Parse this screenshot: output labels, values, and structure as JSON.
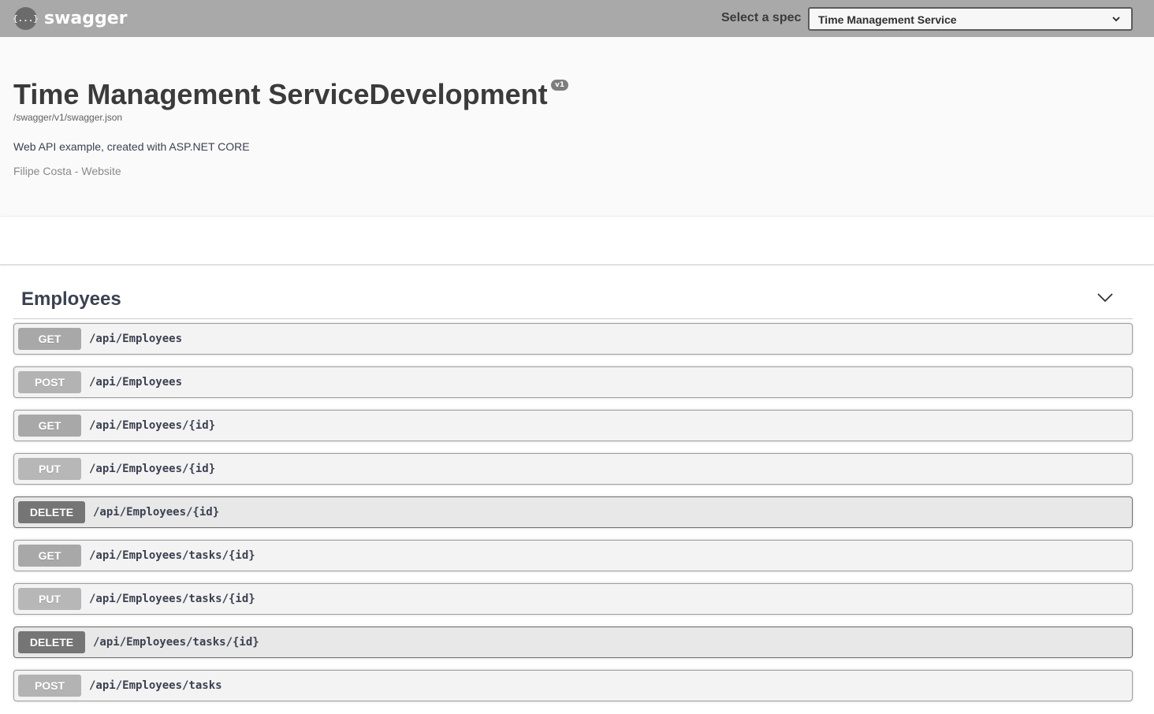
{
  "topbar": {
    "logo_icon_text": "{...}",
    "logo_text": "swagger",
    "spec_label": "Select a spec",
    "spec_selected": "Time Management Service"
  },
  "info": {
    "title": "Time Management ServiceDevelopment",
    "version": "v1",
    "url": "/swagger/v1/swagger.json",
    "description": "Web API example, created with ASP.NET CORE",
    "contact": "Filipe Costa - Website"
  },
  "tag": {
    "name": "Employees"
  },
  "colors": {
    "get": "#a8a8a8",
    "post": "#b3b3b3",
    "put": "#b7b7b7",
    "delete": "#757575"
  },
  "operations": [
    {
      "method": "GET",
      "path": "/api/Employees"
    },
    {
      "method": "POST",
      "path": "/api/Employees"
    },
    {
      "method": "GET",
      "path": "/api/Employees/{id}"
    },
    {
      "method": "PUT",
      "path": "/api/Employees/{id}"
    },
    {
      "method": "DELETE",
      "path": "/api/Employees/{id}"
    },
    {
      "method": "GET",
      "path": "/api/Employees/tasks/{id}"
    },
    {
      "method": "PUT",
      "path": "/api/Employees/tasks/{id}"
    },
    {
      "method": "DELETE",
      "path": "/api/Employees/tasks/{id}"
    },
    {
      "method": "POST",
      "path": "/api/Employees/tasks"
    }
  ]
}
